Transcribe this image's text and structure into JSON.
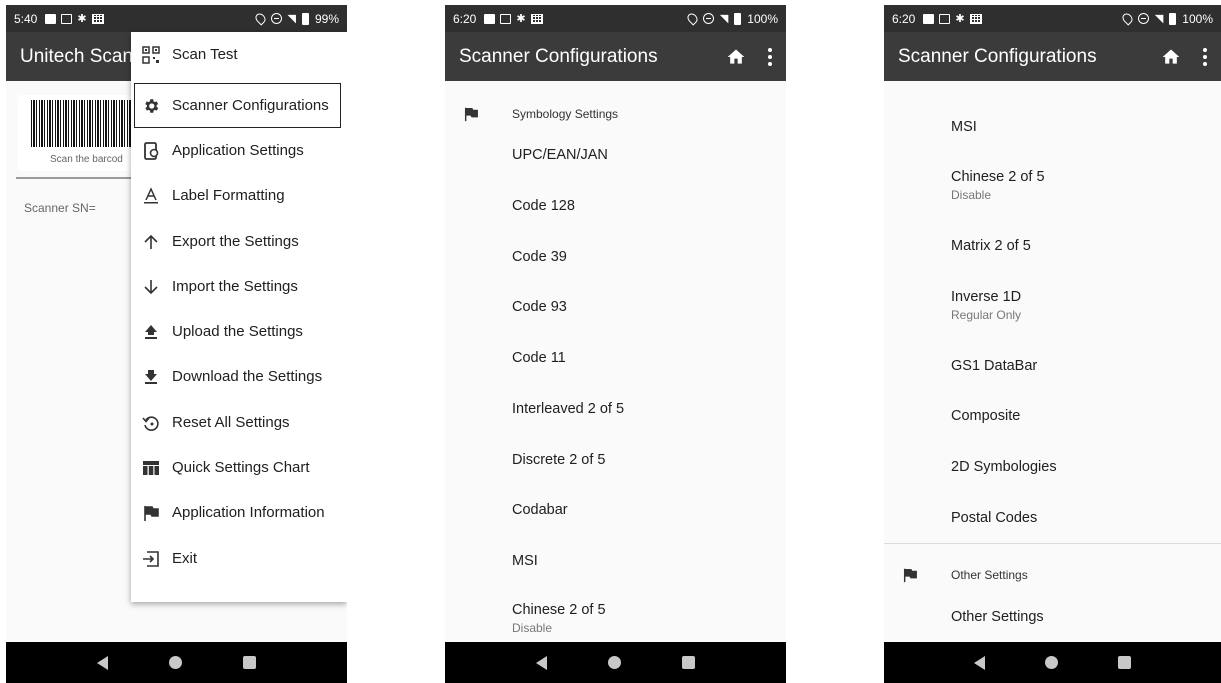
{
  "panel1": {
    "status": {
      "time": "5:40",
      "battery": "99%"
    },
    "appbar_title": "Unitech Scan",
    "scan_caption": "Scan the barcod",
    "scanner_sn": "Scanner SN=",
    "menu": [
      {
        "label": "Scan Test",
        "icon": "qr-code-icon"
      },
      {
        "label": "Scanner Configurations",
        "icon": "gear-icon"
      },
      {
        "label": "Application Settings",
        "icon": "device-settings-icon"
      },
      {
        "label": "Label Formatting",
        "icon": "text-format-icon"
      },
      {
        "label": "Export the Settings",
        "icon": "arrow-up-icon"
      },
      {
        "label": "Import the Settings",
        "icon": "arrow-down-icon"
      },
      {
        "label": "Upload the Settings",
        "icon": "upload-icon"
      },
      {
        "label": "Download the Settings",
        "icon": "download-icon"
      },
      {
        "label": "Reset All Settings",
        "icon": "reset-icon"
      },
      {
        "label": "Quick Settings Chart",
        "icon": "table-chart-icon"
      },
      {
        "label": "Application Information",
        "icon": "flag-icon"
      },
      {
        "label": "Exit",
        "icon": "exit-icon"
      }
    ]
  },
  "panel2": {
    "status": {
      "time": "6:20",
      "battery": "100%"
    },
    "appbar_title": "Scanner Configurations",
    "section_title": "Symbology Settings",
    "items": [
      {
        "label": "UPC/EAN/JAN"
      },
      {
        "label": "Code 128"
      },
      {
        "label": "Code 39"
      },
      {
        "label": "Code 93"
      },
      {
        "label": "Code 11"
      },
      {
        "label": "Interleaved 2 of 5"
      },
      {
        "label": "Discrete 2 of 5"
      },
      {
        "label": "Codabar"
      },
      {
        "label": "MSI"
      },
      {
        "label": "Chinese 2 of 5",
        "summary": "Disable"
      }
    ]
  },
  "panel3": {
    "status": {
      "time": "6:20",
      "battery": "100%"
    },
    "appbar_title": "Scanner Configurations",
    "items": [
      {
        "label": "MSI"
      },
      {
        "label": "Chinese 2 of 5",
        "summary": "Disable"
      },
      {
        "label": "Matrix 2 of 5"
      },
      {
        "label": "Inverse 1D",
        "summary": "Regular Only"
      },
      {
        "label": "GS1 DataBar"
      },
      {
        "label": "Composite"
      },
      {
        "label": "2D Symbologies"
      },
      {
        "label": "Postal Codes"
      }
    ],
    "section2_title": "Other Settings",
    "section2_items": [
      {
        "label": "Other Settings"
      }
    ]
  },
  "colors": {
    "statusbar": "#2f2f2f",
    "appbar": "#3b3b3b",
    "navbar": "#000000",
    "background": "#fafafa"
  }
}
